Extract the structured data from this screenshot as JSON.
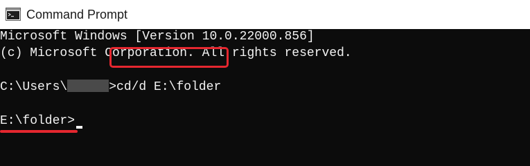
{
  "window": {
    "title": "Command Prompt",
    "icon": "cmd-app-icon"
  },
  "console": {
    "version_line": "Microsoft Windows [Version 10.0.22000.856]",
    "copyright_line": "(c) Microsoft Corporation. All rights reserved.",
    "prompt1_prefix": "C:\\Users\\",
    "prompt1_suffix": ">",
    "command": "cd/d E:\\folder",
    "prompt2": "E:\\folder>"
  },
  "colors": {
    "background": "#0c0c0c",
    "text": "#f2f2f2",
    "highlight": "#e5272f",
    "titlebar": "#ffffff"
  }
}
